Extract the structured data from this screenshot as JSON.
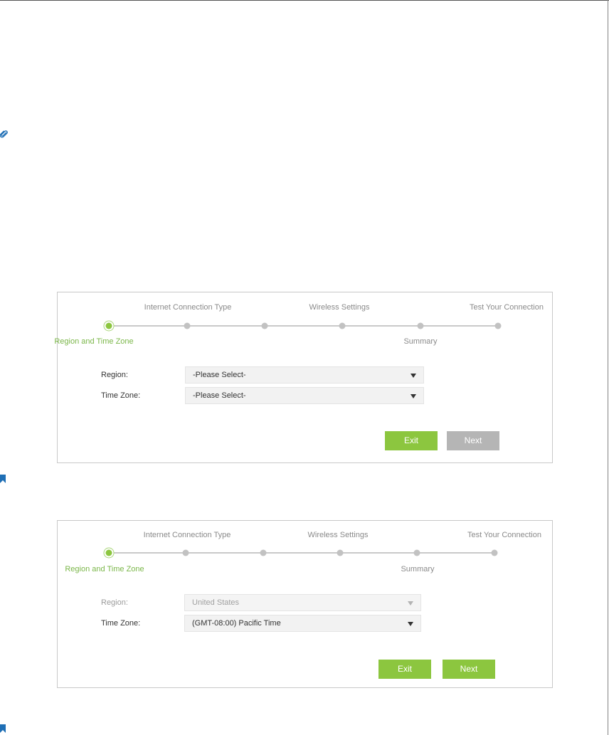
{
  "icons": {
    "clip": "paperclip-icon",
    "bookmark": "bookmark-icon",
    "accent_green": "#8cc63f",
    "accent_blue": "#1f6fb5"
  },
  "panel1": {
    "steps_top": [
      "Internet Connection Type",
      "Wireless Settings",
      "Test Your Connection"
    ],
    "steps_bottom": [
      "Region and Time Zone",
      "Summary"
    ],
    "region_label": "Region:",
    "region_value": "-Please Select-",
    "timezone_label": "Time Zone:",
    "timezone_value": "-Please Select-",
    "exit_label": "Exit",
    "next_label": "Next"
  },
  "panel2": {
    "steps_top": [
      "Internet Connection Type",
      "Wireless Settings",
      "Test Your Connection"
    ],
    "steps_bottom": [
      "Region and Time Zone",
      "Summary"
    ],
    "region_label": "Region:",
    "region_value": "United States",
    "timezone_label": "Time Zone:",
    "timezone_value": "(GMT-08:00) Pacific Time",
    "exit_label": "Exit",
    "next_label": "Next"
  }
}
